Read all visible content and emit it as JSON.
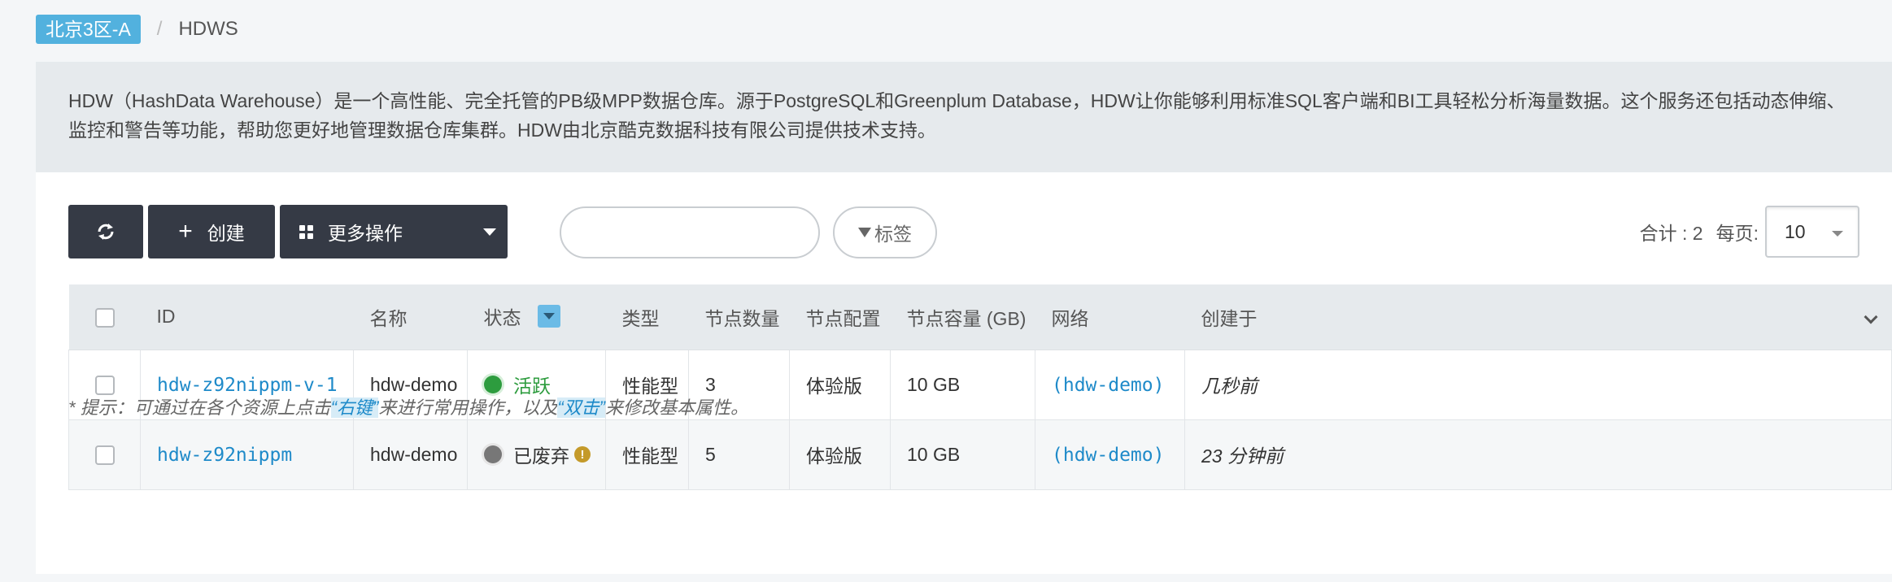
{
  "breadcrumb": {
    "zone": "北京3区-A",
    "separator": "/",
    "current": "HDWS"
  },
  "intro": {
    "text": "HDW（HashData Warehouse）是一个高性能、完全托管的PB级MPP数据仓库。源于PostgreSQL和Greenplum Database，HDW让你能够利用标准SQL客户端和BI工具轻松分析海量数据。这个服务还包括动态伸缩、监控和警告等功能，帮助您更好地管理数据仓库集群。HDW由北京酷克数据科技有限公司提供技术支持。"
  },
  "toolbar": {
    "refresh_icon": "refresh-icon",
    "create_label": "创建",
    "more_label": "更多操作",
    "search_placeholder": "",
    "tag_label": "标签",
    "total_label": "合计 : 2",
    "per_page_label": "每页:",
    "per_page_value": "10"
  },
  "table": {
    "headers": {
      "id": "ID",
      "name": "名称",
      "status": "状态",
      "type": "类型",
      "node_count": "节点数量",
      "node_config": "节点配置",
      "node_capacity": "节点容量 (GB)",
      "network": "网络",
      "created": "创建于"
    },
    "rows": [
      {
        "id": "hdw-z92nippm-v-1",
        "name": "hdw-demo",
        "status": "活跃",
        "status_color": "#2d9c3e",
        "type": "性能型",
        "node_count": "3",
        "node_config": "体验版",
        "node_capacity": "10 GB",
        "network": "(hdw-demo)",
        "created": "几秒前"
      },
      {
        "id": "hdw-z92nippm",
        "name": "hdw-demo",
        "status": "已废弃",
        "status_color": "#777777",
        "type": "性能型",
        "node_count": "5",
        "node_config": "体验版",
        "node_capacity": "10 GB",
        "network": "(hdw-demo)",
        "created": "23 分钟前"
      }
    ]
  },
  "tip": {
    "prefix": "* 提示：可通过在各个资源上点击",
    "right_click": "“右键”",
    "middle": "来进行常用操作，以及",
    "double_click": "“双击”",
    "suffix": "来修改基本属性。"
  },
  "colors": {
    "accent": "#52b1de",
    "link": "#1e8ac9",
    "dark_button": "#353a45",
    "active": "#2d9c3e"
  }
}
